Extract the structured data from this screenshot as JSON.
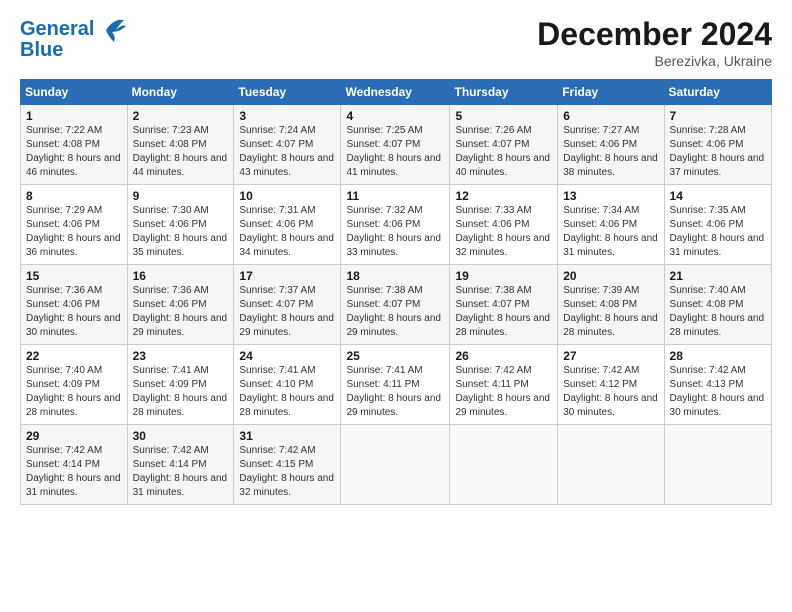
{
  "header": {
    "logo_line1": "General",
    "logo_line2": "Blue",
    "month": "December 2024",
    "location": "Berezivka, Ukraine"
  },
  "days_of_week": [
    "Sunday",
    "Monday",
    "Tuesday",
    "Wednesday",
    "Thursday",
    "Friday",
    "Saturday"
  ],
  "weeks": [
    [
      {
        "day": "1",
        "sunrise": "7:22 AM",
        "sunset": "4:08 PM",
        "daylight": "8 hours and 46 minutes."
      },
      {
        "day": "2",
        "sunrise": "7:23 AM",
        "sunset": "4:08 PM",
        "daylight": "8 hours and 44 minutes."
      },
      {
        "day": "3",
        "sunrise": "7:24 AM",
        "sunset": "4:07 PM",
        "daylight": "8 hours and 43 minutes."
      },
      {
        "day": "4",
        "sunrise": "7:25 AM",
        "sunset": "4:07 PM",
        "daylight": "8 hours and 41 minutes."
      },
      {
        "day": "5",
        "sunrise": "7:26 AM",
        "sunset": "4:07 PM",
        "daylight": "8 hours and 40 minutes."
      },
      {
        "day": "6",
        "sunrise": "7:27 AM",
        "sunset": "4:06 PM",
        "daylight": "8 hours and 38 minutes."
      },
      {
        "day": "7",
        "sunrise": "7:28 AM",
        "sunset": "4:06 PM",
        "daylight": "8 hours and 37 minutes."
      }
    ],
    [
      {
        "day": "8",
        "sunrise": "7:29 AM",
        "sunset": "4:06 PM",
        "daylight": "8 hours and 36 minutes."
      },
      {
        "day": "9",
        "sunrise": "7:30 AM",
        "sunset": "4:06 PM",
        "daylight": "8 hours and 35 minutes."
      },
      {
        "day": "10",
        "sunrise": "7:31 AM",
        "sunset": "4:06 PM",
        "daylight": "8 hours and 34 minutes."
      },
      {
        "day": "11",
        "sunrise": "7:32 AM",
        "sunset": "4:06 PM",
        "daylight": "8 hours and 33 minutes."
      },
      {
        "day": "12",
        "sunrise": "7:33 AM",
        "sunset": "4:06 PM",
        "daylight": "8 hours and 32 minutes."
      },
      {
        "day": "13",
        "sunrise": "7:34 AM",
        "sunset": "4:06 PM",
        "daylight": "8 hours and 31 minutes."
      },
      {
        "day": "14",
        "sunrise": "7:35 AM",
        "sunset": "4:06 PM",
        "daylight": "8 hours and 31 minutes."
      }
    ],
    [
      {
        "day": "15",
        "sunrise": "7:36 AM",
        "sunset": "4:06 PM",
        "daylight": "8 hours and 30 minutes."
      },
      {
        "day": "16",
        "sunrise": "7:36 AM",
        "sunset": "4:06 PM",
        "daylight": "8 hours and 29 minutes."
      },
      {
        "day": "17",
        "sunrise": "7:37 AM",
        "sunset": "4:07 PM",
        "daylight": "8 hours and 29 minutes."
      },
      {
        "day": "18",
        "sunrise": "7:38 AM",
        "sunset": "4:07 PM",
        "daylight": "8 hours and 29 minutes."
      },
      {
        "day": "19",
        "sunrise": "7:38 AM",
        "sunset": "4:07 PM",
        "daylight": "8 hours and 28 minutes."
      },
      {
        "day": "20",
        "sunrise": "7:39 AM",
        "sunset": "4:08 PM",
        "daylight": "8 hours and 28 minutes."
      },
      {
        "day": "21",
        "sunrise": "7:40 AM",
        "sunset": "4:08 PM",
        "daylight": "8 hours and 28 minutes."
      }
    ],
    [
      {
        "day": "22",
        "sunrise": "7:40 AM",
        "sunset": "4:09 PM",
        "daylight": "8 hours and 28 minutes."
      },
      {
        "day": "23",
        "sunrise": "7:41 AM",
        "sunset": "4:09 PM",
        "daylight": "8 hours and 28 minutes."
      },
      {
        "day": "24",
        "sunrise": "7:41 AM",
        "sunset": "4:10 PM",
        "daylight": "8 hours and 28 minutes."
      },
      {
        "day": "25",
        "sunrise": "7:41 AM",
        "sunset": "4:11 PM",
        "daylight": "8 hours and 29 minutes."
      },
      {
        "day": "26",
        "sunrise": "7:42 AM",
        "sunset": "4:11 PM",
        "daylight": "8 hours and 29 minutes."
      },
      {
        "day": "27",
        "sunrise": "7:42 AM",
        "sunset": "4:12 PM",
        "daylight": "8 hours and 30 minutes."
      },
      {
        "day": "28",
        "sunrise": "7:42 AM",
        "sunset": "4:13 PM",
        "daylight": "8 hours and 30 minutes."
      }
    ],
    [
      {
        "day": "29",
        "sunrise": "7:42 AM",
        "sunset": "4:14 PM",
        "daylight": "8 hours and 31 minutes."
      },
      {
        "day": "30",
        "sunrise": "7:42 AM",
        "sunset": "4:14 PM",
        "daylight": "8 hours and 31 minutes."
      },
      {
        "day": "31",
        "sunrise": "7:42 AM",
        "sunset": "4:15 PM",
        "daylight": "8 hours and 32 minutes."
      },
      null,
      null,
      null,
      null
    ]
  ]
}
